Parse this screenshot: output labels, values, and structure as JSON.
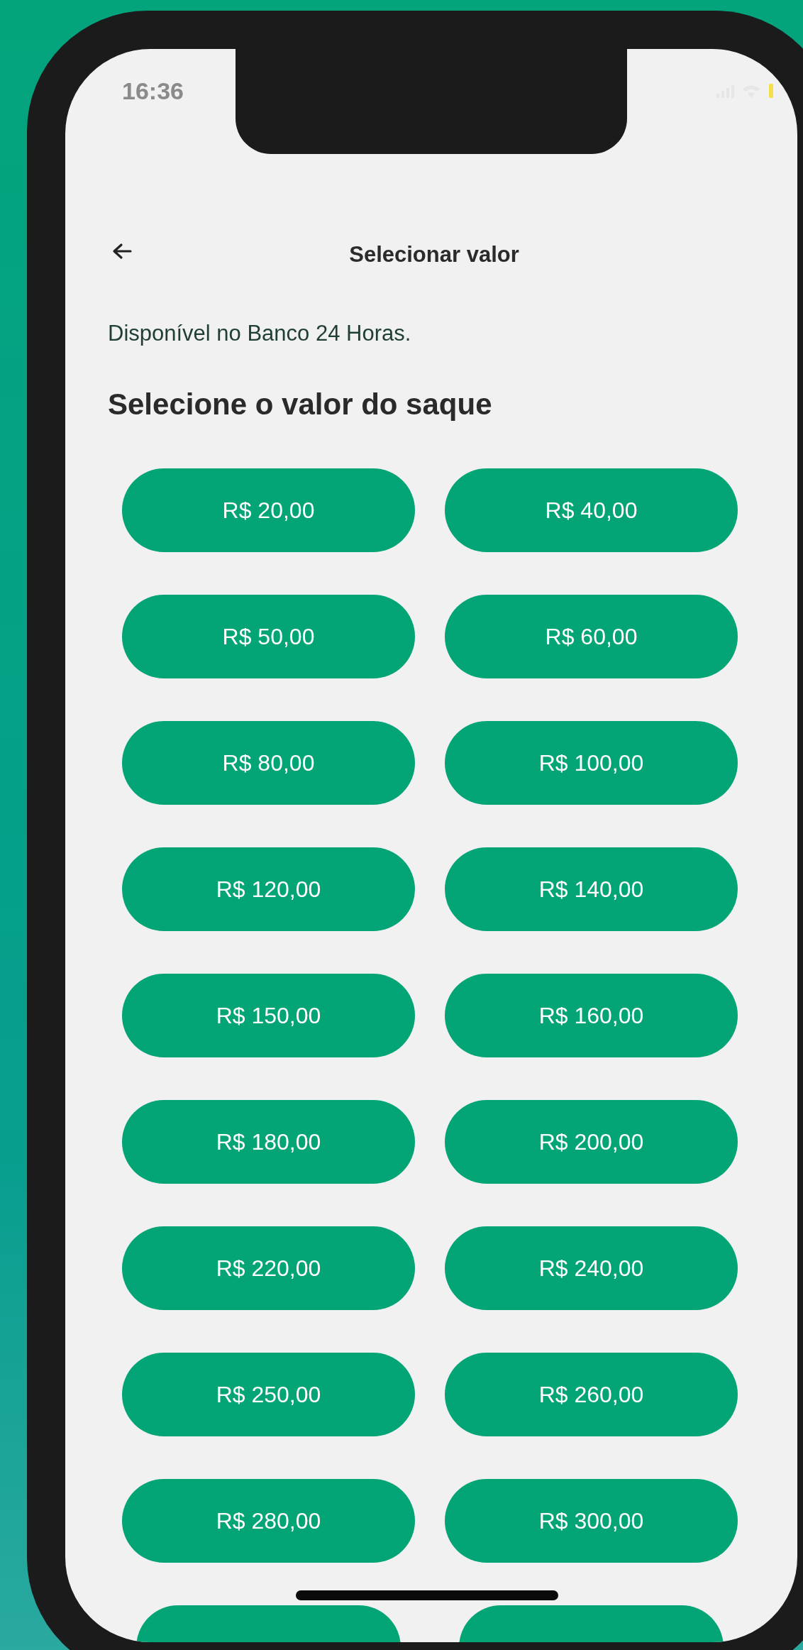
{
  "status_bar": {
    "time": "16:36"
  },
  "header": {
    "title": "Selecionar valor"
  },
  "subtitle": "Disponível no Banco 24 Horas.",
  "heading": "Selecione o valor do saque",
  "amounts": [
    "R$ 20,00",
    "R$ 40,00",
    "R$ 50,00",
    "R$ 60,00",
    "R$ 80,00",
    "R$ 100,00",
    "R$ 120,00",
    "R$ 140,00",
    "R$ 150,00",
    "R$ 160,00",
    "R$ 180,00",
    "R$ 200,00",
    "R$ 220,00",
    "R$ 240,00",
    "R$ 250,00",
    "R$ 260,00",
    "R$ 280,00",
    "R$ 300,00"
  ]
}
